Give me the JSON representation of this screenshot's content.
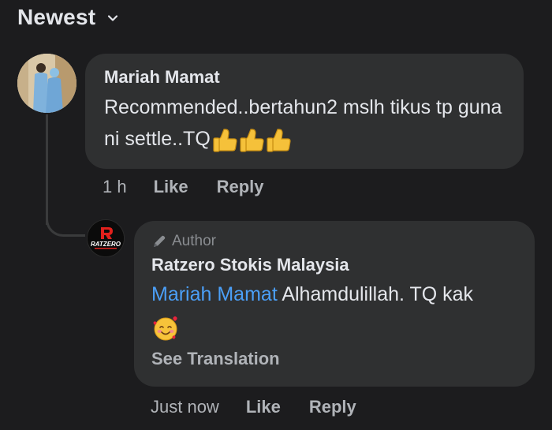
{
  "sort": {
    "label": "Newest",
    "icon": "chevron-down-icon"
  },
  "comments": [
    {
      "author": "Mariah Mamat",
      "avatar": "profile-photo",
      "text": "Recommended..bertahun2 mslh tikus tp guna ni settle..TQ",
      "emojis": [
        "thumbs-up-icon",
        "thumbs-up-icon",
        "thumbs-up-icon"
      ],
      "time": "1 h",
      "like_label": "Like",
      "reply_label": "Reply"
    }
  ],
  "reply": {
    "badge_label": "Author",
    "badge_icon": "pen-icon",
    "author": "Ratzero Stokis Malaysia",
    "avatar": "ratzero-logo",
    "logo_text": "RATZERO",
    "mention": "Mariah Mamat",
    "text": " Alhamdulillah. TQ kak",
    "emoji": "smiling-face-with-hearts-icon",
    "see_translation": "See Translation",
    "time": "Just now",
    "like_label": "Like",
    "reply_label": "Reply"
  },
  "colors": {
    "background": "#1c1c1e",
    "bubble": "#2f3031",
    "mention": "#4b9ff7",
    "secondary_text": "#b0b3b8"
  }
}
